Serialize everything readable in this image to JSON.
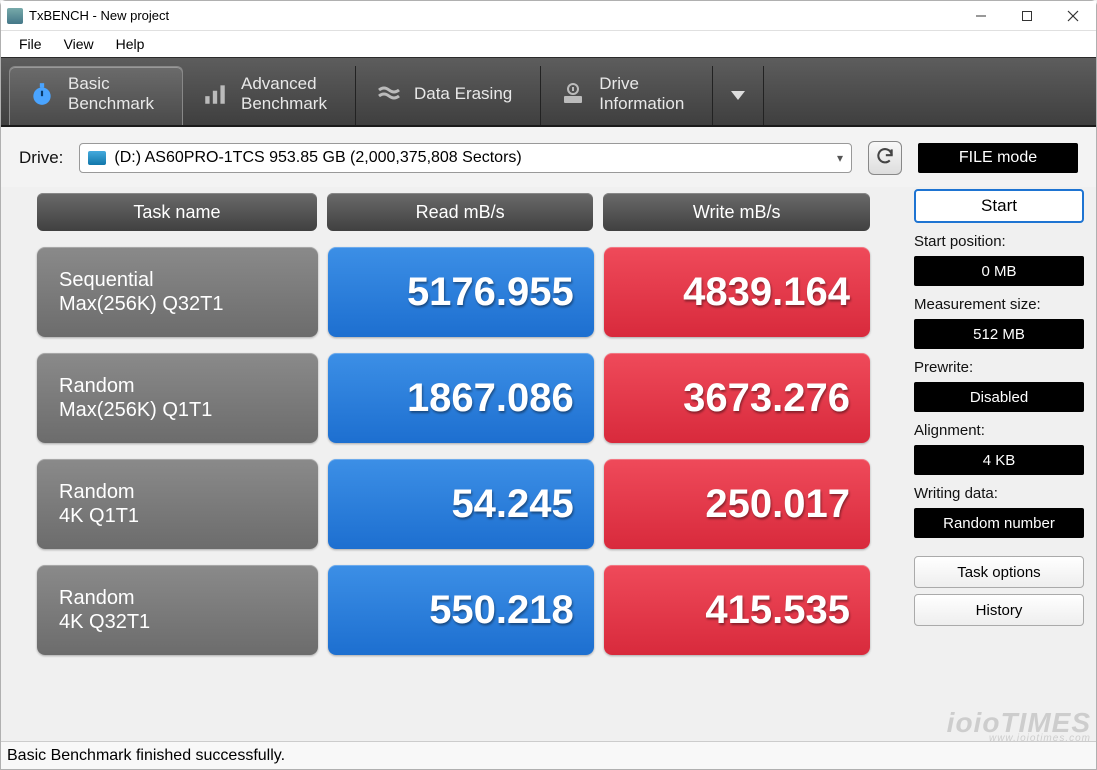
{
  "window": {
    "title": "TxBENCH - New project"
  },
  "menu": {
    "file": "File",
    "view": "View",
    "help": "Help"
  },
  "tabs": {
    "basic": "Basic\nBenchmark",
    "advanced": "Advanced\nBenchmark",
    "erasing": "Data Erasing",
    "driveinfo": "Drive\nInformation"
  },
  "drive": {
    "label": "Drive:",
    "value": "(D:) AS60PRO-1TCS  953.85 GB (2,000,375,808 Sectors)",
    "filemode": "FILE mode"
  },
  "headers": {
    "task": "Task name",
    "read": "Read mB/s",
    "write": "Write mB/s"
  },
  "rows": [
    {
      "task": "Sequential\nMax(256K) Q32T1",
      "read": "5176.955",
      "write": "4839.164"
    },
    {
      "task": "Random\nMax(256K) Q1T1",
      "read": "1867.086",
      "write": "3673.276"
    },
    {
      "task": "Random\n4K Q1T1",
      "read": "54.245",
      "write": "250.017"
    },
    {
      "task": "Random\n4K Q32T1",
      "read": "550.218",
      "write": "415.535"
    }
  ],
  "side": {
    "start": "Start",
    "start_pos_label": "Start position:",
    "start_pos": "0 MB",
    "meas_label": "Measurement size:",
    "meas": "512 MB",
    "prewrite_label": "Prewrite:",
    "prewrite": "Disabled",
    "align_label": "Alignment:",
    "align": "4 KB",
    "writing_label": "Writing data:",
    "writing": "Random number",
    "task_options": "Task options",
    "history": "History"
  },
  "status": "Basic Benchmark finished successfully.",
  "watermark": "ioioTIMES",
  "watermark_sub": "www.ioiotimes.com",
  "chart_data": {
    "type": "table",
    "title": "TxBENCH Basic Benchmark Results",
    "columns": [
      "Task name",
      "Read mB/s",
      "Write mB/s"
    ],
    "rows": [
      [
        "Sequential Max(256K) Q32T1",
        5176.955,
        4839.164
      ],
      [
        "Random Max(256K) Q1T1",
        1867.086,
        3673.276
      ],
      [
        "Random 4K Q1T1",
        54.245,
        250.017
      ],
      [
        "Random 4K Q32T1",
        550.218,
        415.535
      ]
    ]
  }
}
